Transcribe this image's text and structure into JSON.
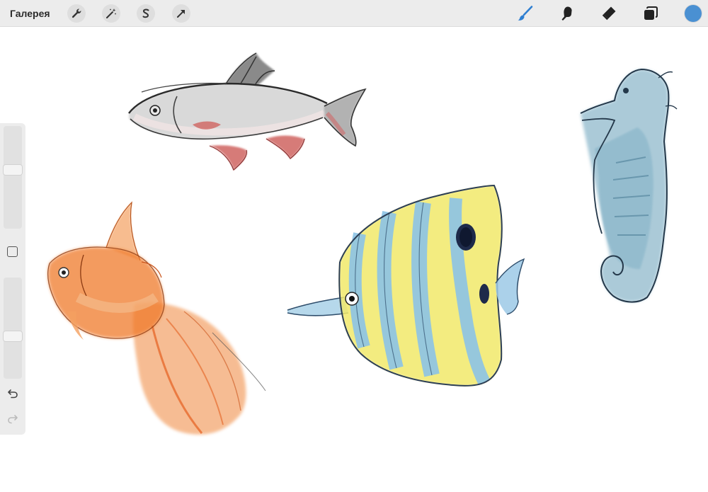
{
  "toolbar": {
    "gallery_label": "Галерея",
    "left_tools": [
      "wrench-icon",
      "magic-wand-icon",
      "selection-icon",
      "transform-arrow-icon"
    ],
    "right_tools": [
      "brush-icon",
      "smudge-icon",
      "eraser-icon",
      "layers-icon"
    ],
    "active_tool": "brush-icon",
    "current_color": "#4a90d2"
  },
  "sidebar": {
    "brush_size": 0.58,
    "opacity": 0.41,
    "undo_enabled": true,
    "redo_enabled": false
  },
  "canvas": {
    "drawings": [
      "roach-fish",
      "goldfish",
      "butterflyfish",
      "seahorse"
    ]
  }
}
